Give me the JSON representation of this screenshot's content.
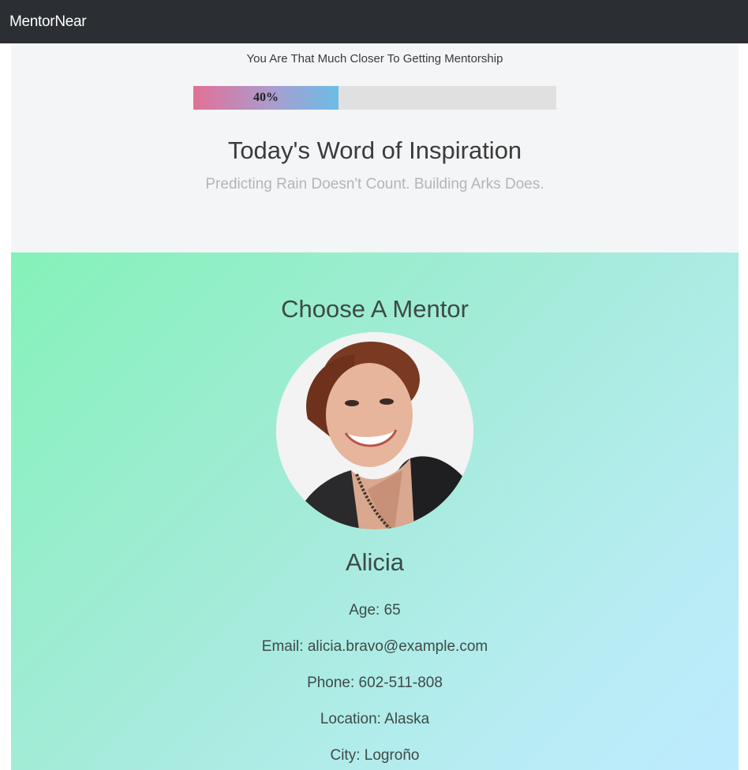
{
  "navbar": {
    "brand": "MentorNear"
  },
  "progress": {
    "tagline": "You Are That Much Closer To Getting Mentorship",
    "percent": 40,
    "label": "40%",
    "fill_colors": [
      "#e27096",
      "#6bbde5"
    ]
  },
  "inspiration": {
    "title": "Today's Word of Inspiration",
    "quote": "Predicting Rain Doesn't Count. Building Arks Does."
  },
  "mentor": {
    "section_title": "Choose A Mentor",
    "name": "Alicia",
    "age": "Age: 65",
    "email": "Email: alicia.bravo@example.com",
    "phone": "Phone: 602-511-808",
    "location": "Location: Alaska",
    "city": "City: Logroño"
  },
  "colors": {
    "navbar_bg": "#2b2f33",
    "top_section_bg": "#f4f5f7",
    "mentor_gradient_start": "#84f2b9",
    "mentor_gradient_end": "#bdebff"
  }
}
